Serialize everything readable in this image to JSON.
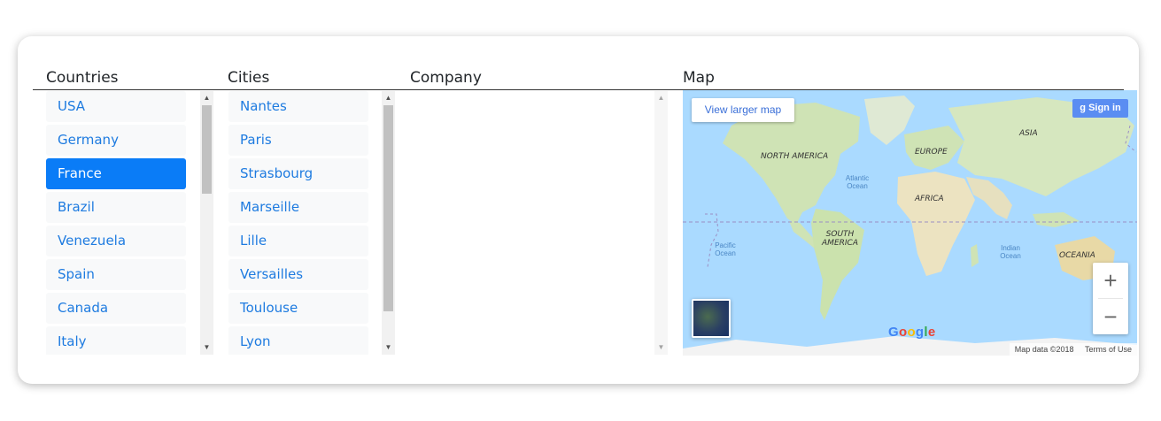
{
  "headers": {
    "countries": "Countries",
    "cities": "Cities",
    "company": "Company",
    "map": "Map"
  },
  "countries": [
    "USA",
    "Germany",
    "France",
    "Brazil",
    "Venezuela",
    "Spain",
    "Canada",
    "Italy"
  ],
  "selected_country": "France",
  "cities": [
    "Nantes",
    "Paris",
    "Strasbourg",
    "Marseille",
    "Lille",
    "Versailles",
    "Toulouse",
    "Lyon"
  ],
  "company_items": [],
  "map": {
    "view_larger": "View larger map",
    "sign_in": "Sign in",
    "zoom_in": "+",
    "zoom_out": "−",
    "google_logo": "Google",
    "attribution": "Map data ©2018",
    "terms": "Terms of Use",
    "labels": {
      "north_america": "NORTH AMERICA",
      "south_america": "SOUTH AMERICA",
      "europe": "EUROPE",
      "asia": "ASIA",
      "africa": "AFRICA",
      "oceania": "OCEANIA",
      "atlantic": "Atlantic Ocean",
      "pacific": "Pacific Ocean",
      "indian": "Indian Ocean"
    }
  },
  "colors": {
    "selected": "#0a7cf7",
    "link": "#1e7be0",
    "water": "#aadaff",
    "land": "#cfe6b8"
  }
}
